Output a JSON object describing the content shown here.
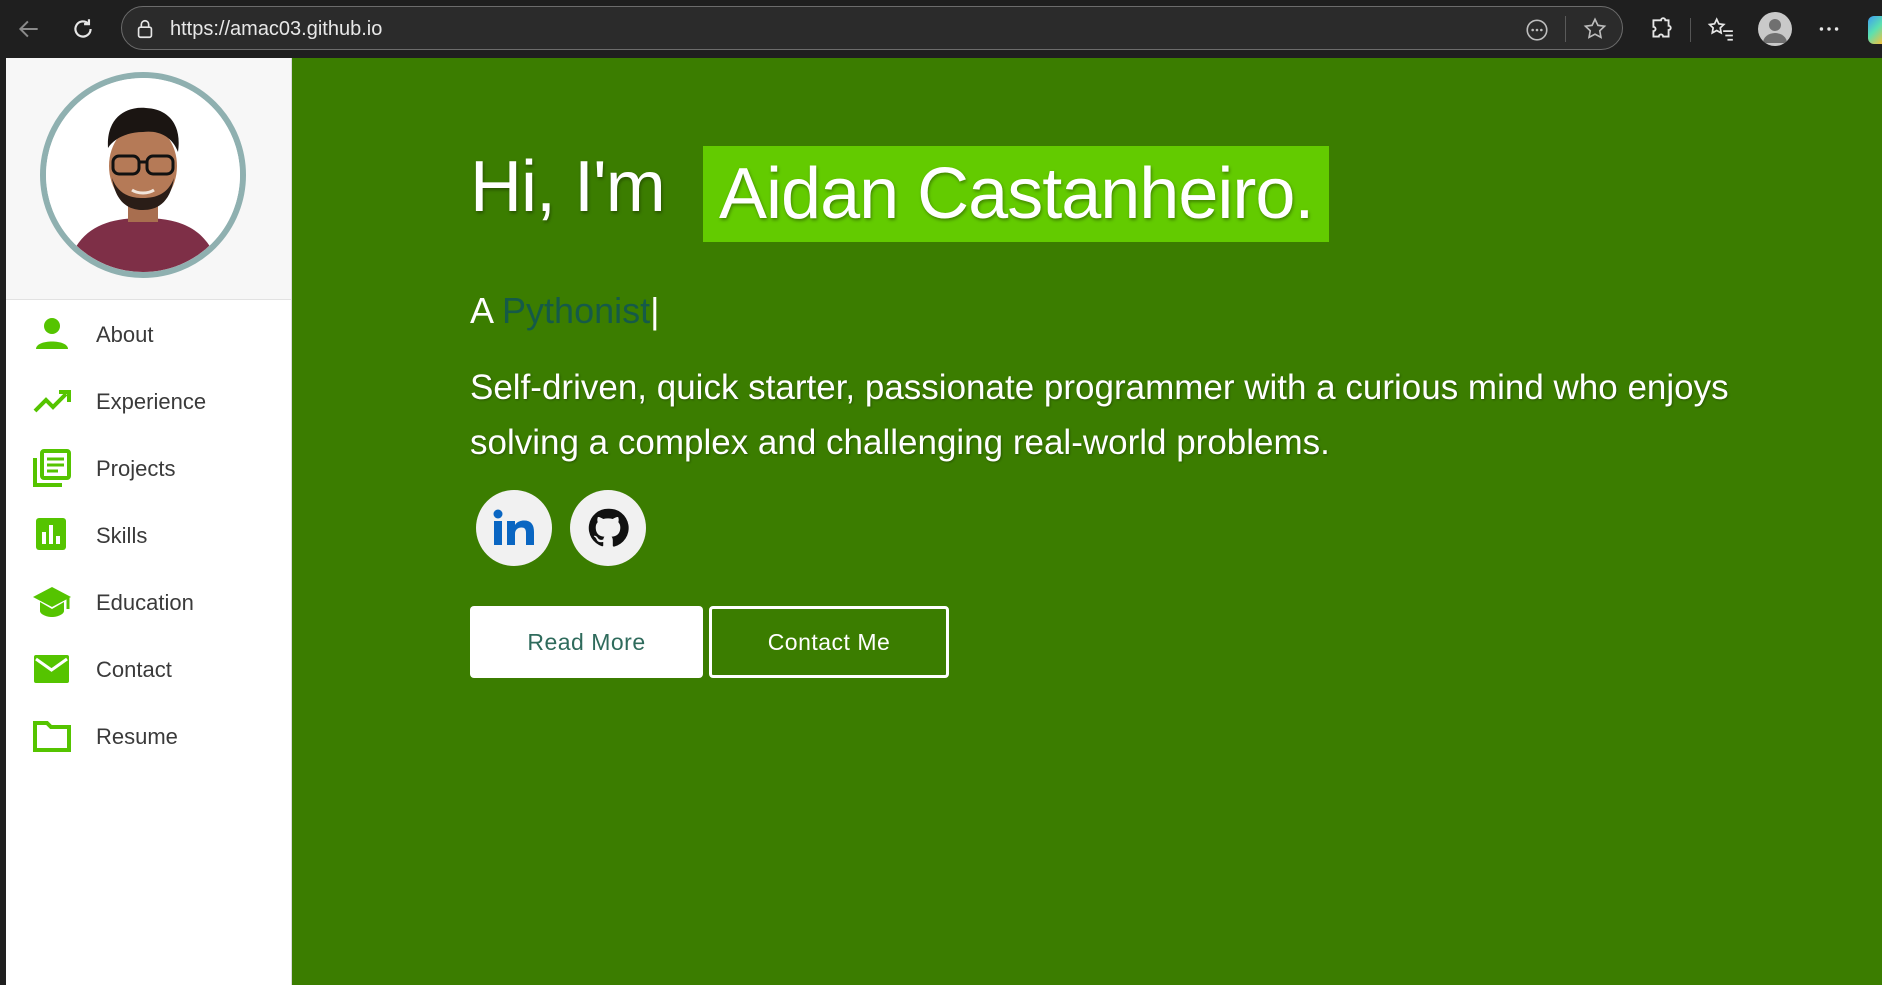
{
  "browser": {
    "url": "https://amac03.github.io"
  },
  "sidebar": {
    "items": [
      {
        "label": "About",
        "icon": "person-icon"
      },
      {
        "label": "Experience",
        "icon": "trending-up-icon"
      },
      {
        "label": "Projects",
        "icon": "library-books-icon"
      },
      {
        "label": "Skills",
        "icon": "bar-chart-icon"
      },
      {
        "label": "Education",
        "icon": "graduation-cap-icon"
      },
      {
        "label": "Contact",
        "icon": "mail-icon"
      },
      {
        "label": "Resume",
        "icon": "folder-icon"
      }
    ]
  },
  "hero": {
    "greeting": "Hi, I'm",
    "name": "Aidan Castanheiro.",
    "role_prefix": "A",
    "role_typed": "Pythonist",
    "role_cursor": "|",
    "intro": "Self-driven, quick starter, passionate programmer with a curious mind who enjoys solving a complex and challenging real-world problems.",
    "read_more": "Read More",
    "contact_me": "Contact Me"
  },
  "colors": {
    "accent": "#63cb00",
    "background": "#3b7d00",
    "icon": "#55c400"
  }
}
